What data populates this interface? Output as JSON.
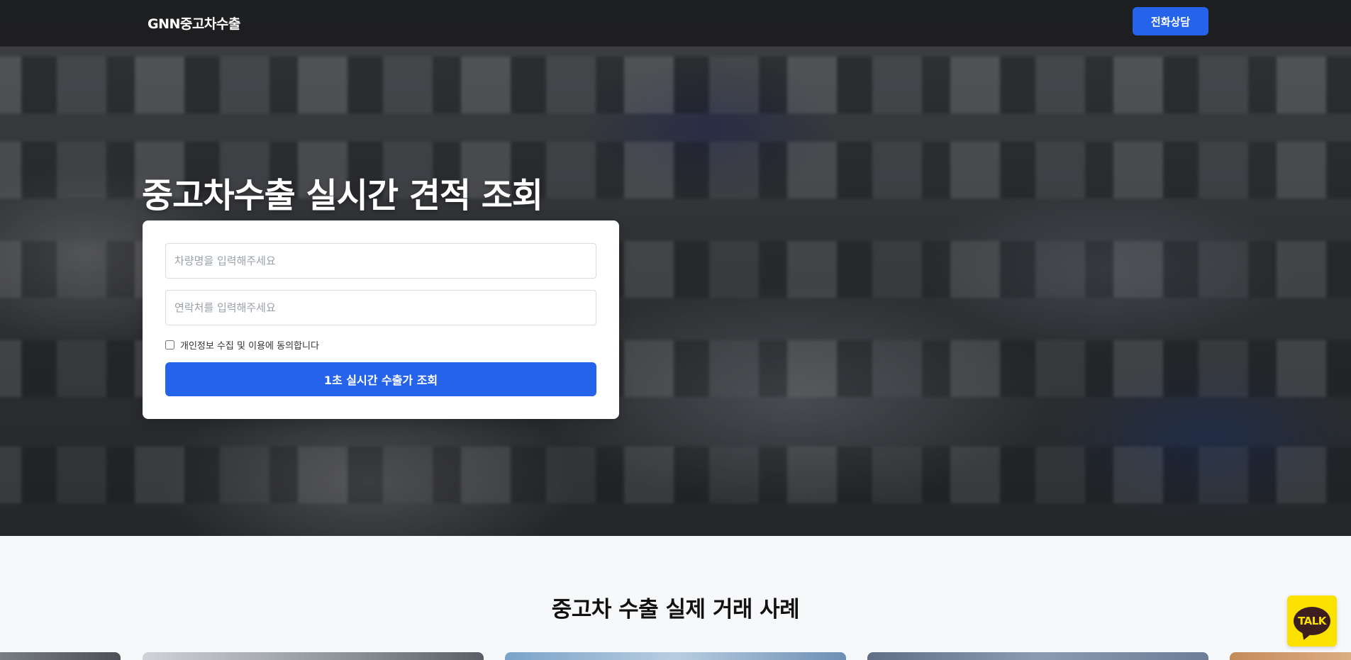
{
  "header": {
    "logo": "GNN중고차수출",
    "call_button": "전화상담"
  },
  "hero": {
    "title": "중고차수출 실시간 견적 조회",
    "form": {
      "vehicle_placeholder": "차량명을 입력해주세요",
      "vehicle_value": "",
      "phone_placeholder": "연락처를 입력해주세요",
      "phone_value": "",
      "agree_label": "개인정보 수집 및 이용에 동의합니다",
      "agree_checked": false,
      "submit_label": "1초 실시간 수출가 조회"
    }
  },
  "cases": {
    "title": "중고차 수출 실제 거래 사례",
    "visible_cards": 5
  },
  "floating": {
    "kakao_label": "TALK"
  },
  "colors": {
    "accent": "#2563eb",
    "kakao": "#fae100",
    "header_bg": "#161618"
  },
  "icons": {
    "kakao": "kakao-talk-icon"
  }
}
